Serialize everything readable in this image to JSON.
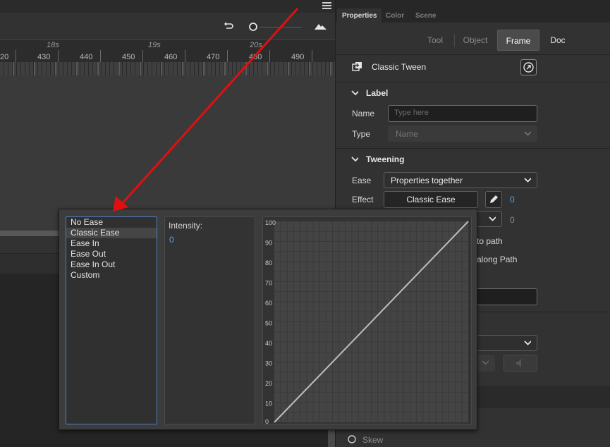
{
  "timeline": {
    "second_labels": [
      "18s",
      "19s",
      "20s"
    ],
    "frame_labels": [
      "20",
      "430",
      "440",
      "450",
      "460",
      "470",
      "480",
      "490"
    ]
  },
  "properties": {
    "tabs": [
      "Properties",
      "Color",
      "Scene"
    ],
    "segments": [
      "Tool",
      "Object",
      "Frame",
      "Doc"
    ],
    "tween_type": "Classic Tween",
    "label_section": {
      "title": "Label",
      "name_label": "Name",
      "name_placeholder": "Type here",
      "type_label": "Type",
      "type_value": "Name"
    },
    "tweening_section": {
      "title": "Tweening",
      "ease_label": "Ease",
      "ease_value": "Properties together",
      "effect_label": "Effect",
      "effect_value": "Classic Ease",
      "effect_number": "0",
      "second_number": "0",
      "partial_orient": "to path",
      "partial_along": "along Path"
    },
    "skew_label": "Skew"
  },
  "ease_popup": {
    "presets": [
      "No Ease",
      "Classic Ease",
      "Ease In",
      "Ease Out",
      "Ease In Out",
      "Custom"
    ],
    "selected": "Classic Ease",
    "intensity_label": "Intensity:",
    "intensity_value": "0",
    "y_ticks": [
      "100",
      "90",
      "80",
      "70",
      "60",
      "50",
      "40",
      "30",
      "20",
      "10",
      "0"
    ]
  },
  "colors": {
    "accent_blue": "#5a9fe0",
    "arrow_red": "#e01010"
  }
}
